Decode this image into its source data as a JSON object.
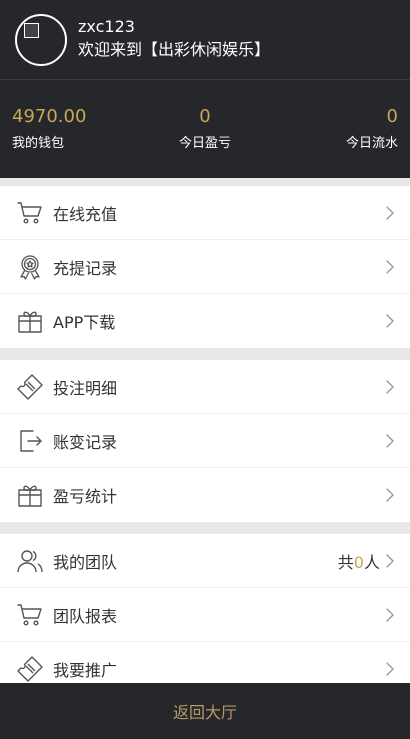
{
  "user": {
    "name": "zxc123",
    "welcome": "欢迎来到【出彩休闲娱乐】"
  },
  "stats": [
    {
      "value": "4970.00",
      "label": "我的钱包"
    },
    {
      "value": "0",
      "label": "今日盈亏"
    },
    {
      "value": "0",
      "label": "今日流水"
    }
  ],
  "groups": [
    [
      {
        "label": "在线充值",
        "icon": "cart-icon"
      },
      {
        "label": "充提记录",
        "icon": "award-icon"
      },
      {
        "label": "APP下载",
        "icon": "gift-icon"
      }
    ],
    [
      {
        "label": "投注明细",
        "icon": "ticket-icon"
      },
      {
        "label": "账变记录",
        "icon": "exit-icon"
      },
      {
        "label": "盈亏统计",
        "icon": "gift-icon"
      }
    ],
    [
      {
        "label": "我的团队",
        "icon": "users-icon",
        "extra_prefix": "共",
        "extra_num": "0",
        "extra_suffix": "人"
      },
      {
        "label": "团队报表",
        "icon": "cart-icon"
      },
      {
        "label": "我要推广",
        "icon": "ticket-icon"
      }
    ]
  ],
  "footer": {
    "label": "返回大厅"
  },
  "colors": {
    "dark": "#26272b",
    "gold": "#c9a658",
    "footer_text": "#b59b6a"
  }
}
